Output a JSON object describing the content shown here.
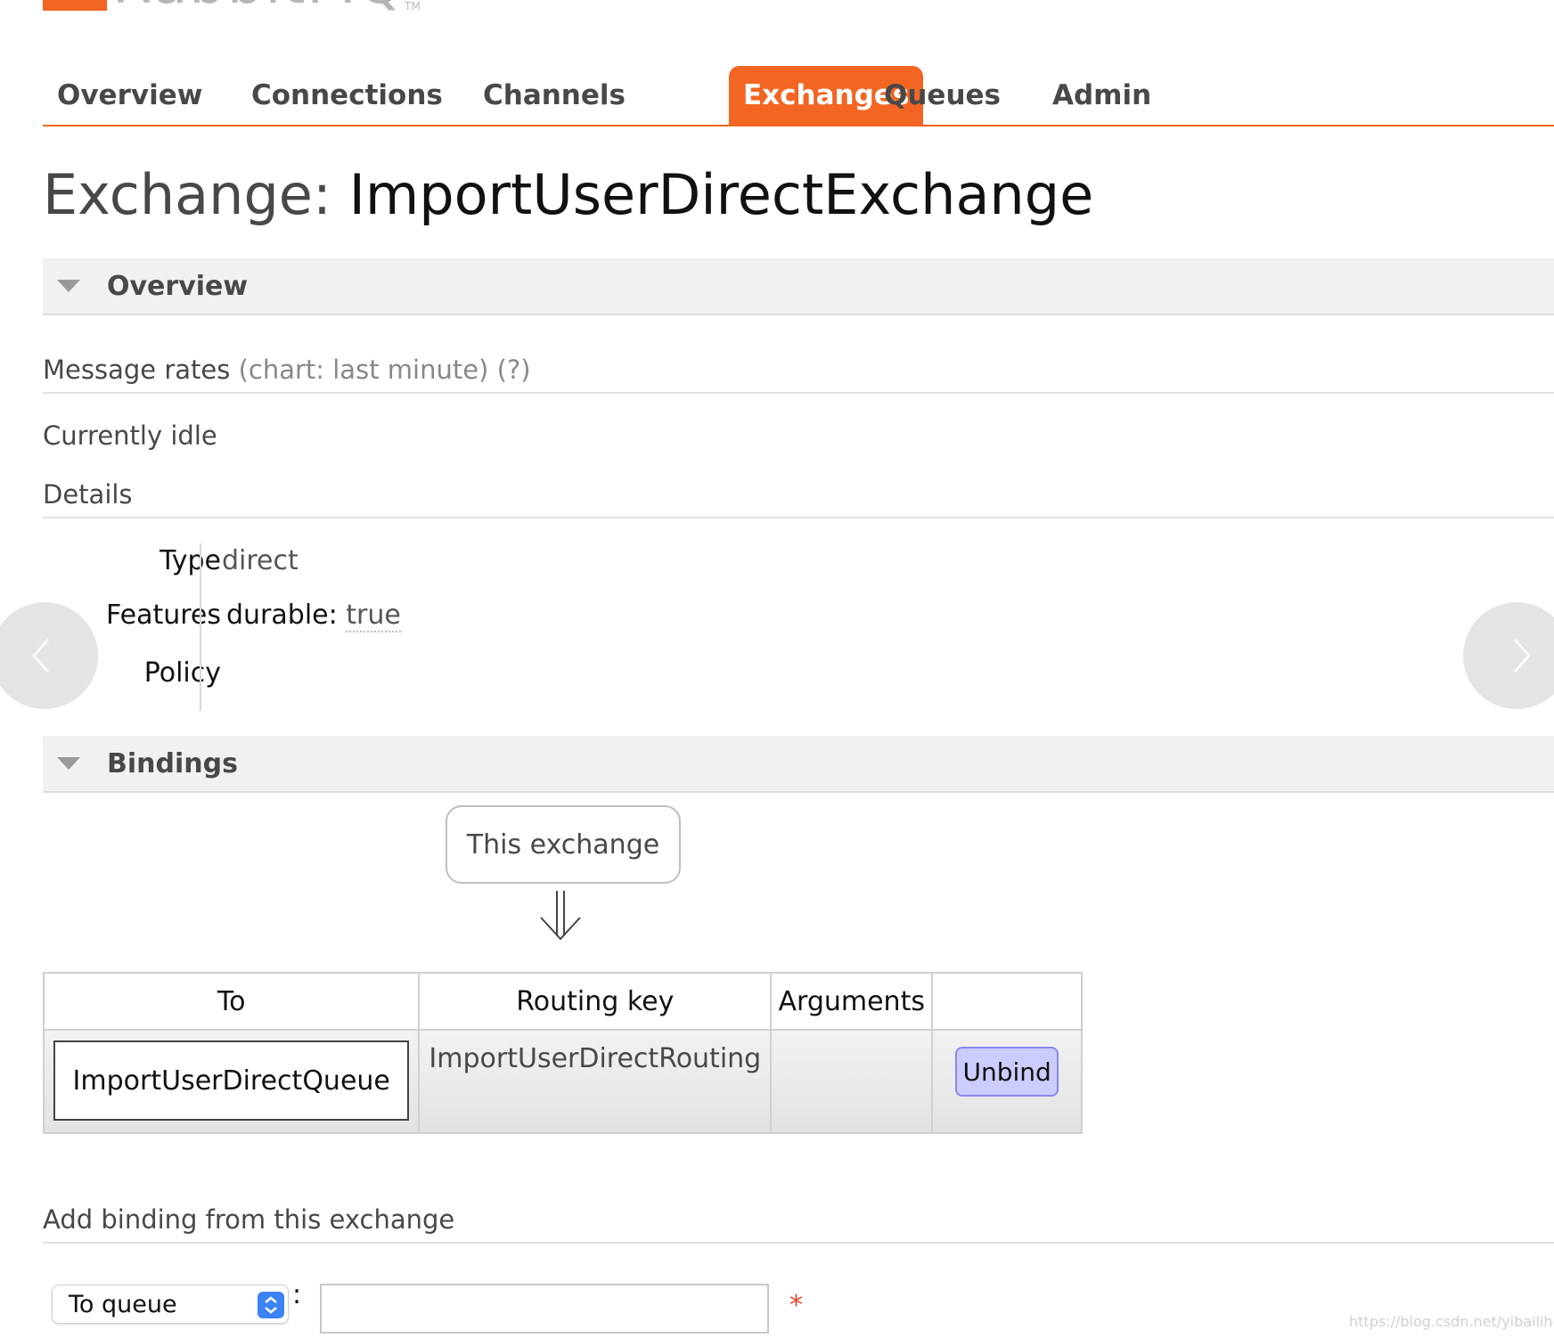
{
  "logo": {
    "text": "RabbitMQ",
    "tm": "TM"
  },
  "nav": {
    "tabs": [
      {
        "label": "Overview"
      },
      {
        "label": "Connections"
      },
      {
        "label": "Channels"
      },
      {
        "label": "Exchanges",
        "active": true
      },
      {
        "label": "Queues"
      },
      {
        "label": "Admin"
      }
    ]
  },
  "page": {
    "title_prefix": "Exchange:",
    "title_name": "ImportUserDirectExchange"
  },
  "overview": {
    "heading": "Overview",
    "message_rates": "Message rates",
    "chart_note": "(chart: last minute) (?)",
    "idle": "Currently idle",
    "details_heading": "Details",
    "details": {
      "type_label": "Type",
      "type_value": "direct",
      "features_label": "Features",
      "features_key": "durable:",
      "features_value": "true",
      "policy_label": "Policy"
    }
  },
  "bindings": {
    "heading": "Bindings",
    "this_exchange": "This exchange",
    "columns": [
      "To",
      "Routing key",
      "Arguments",
      ""
    ],
    "rows": [
      {
        "to": "ImportUserDirectQueue",
        "routing_key": "ImportUserDirectRouting",
        "arguments": "",
        "action": "Unbind"
      }
    ]
  },
  "add_binding": {
    "heading": "Add binding from this exchange",
    "destination_type": "To queue",
    "separator": ":",
    "destination_value": "",
    "required_mark": "*"
  },
  "watermark": "https://blog.csdn.net/yibailiheng",
  "colors": {
    "accent": "#f26522",
    "button_bg": "#ccccff",
    "button_border": "#8888ee",
    "required": "#e0452b"
  }
}
